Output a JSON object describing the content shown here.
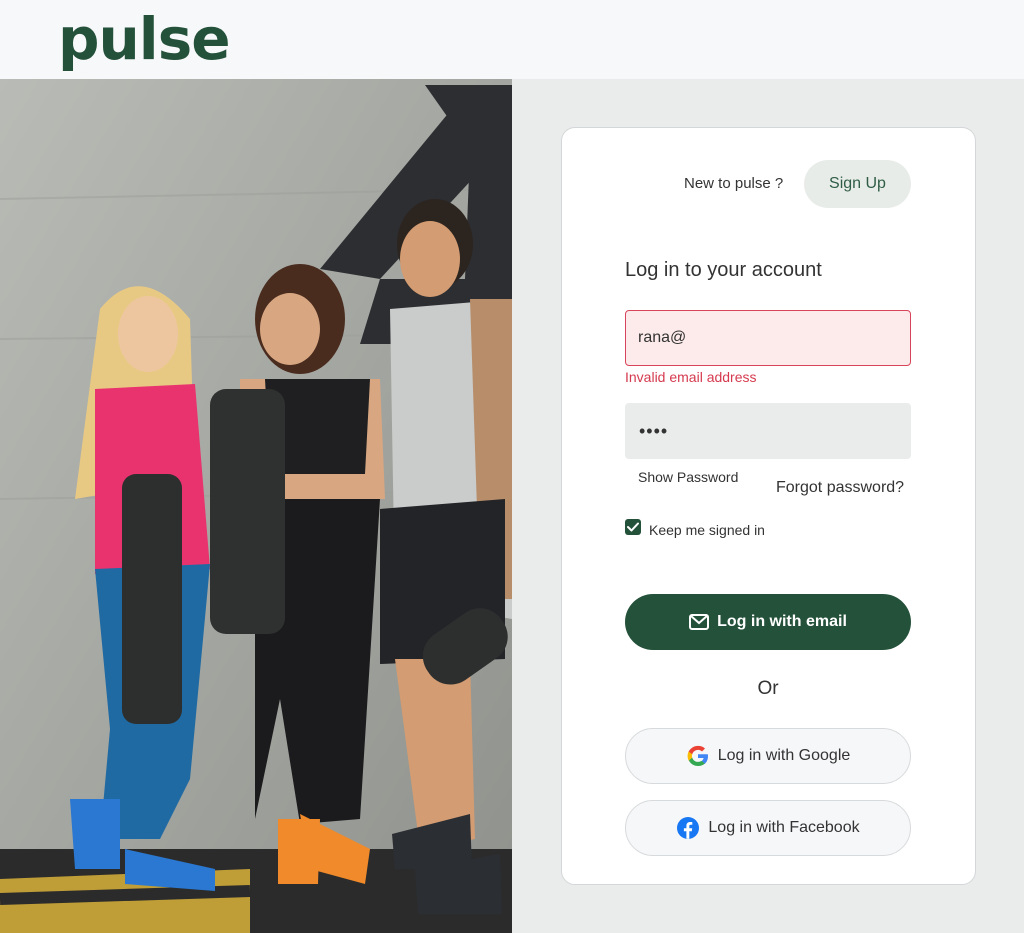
{
  "brand": {
    "logo": "pulse",
    "color": "#24513a"
  },
  "hero": {
    "image": "three people holding yoga mats against a concrete wall"
  },
  "signup": {
    "prompt": "New to pulse ?",
    "button_label": "Sign Up"
  },
  "login": {
    "heading": "Log in to your account",
    "email_value": "rana@",
    "email_error": "Invalid email address",
    "password_mask": "••••",
    "show_password_label": "Show Password",
    "forgot_label": "Forgot password?",
    "keep_signed_in_label": "Keep me signed in",
    "keep_signed_in_checked": true,
    "email_button_label": "Log in with email",
    "or_label": "Or",
    "google_label": "Log in with Google",
    "facebook_label": "Log in with Facebook"
  },
  "icons": {
    "envelope": "envelope-icon",
    "google": "google-icon",
    "facebook": "facebook-icon",
    "check": "check-icon"
  },
  "colors": {
    "error": "#d63a4f",
    "error_bg": "#fdeaea",
    "primary_button": "#24513a",
    "facebook": "#1877f2"
  }
}
